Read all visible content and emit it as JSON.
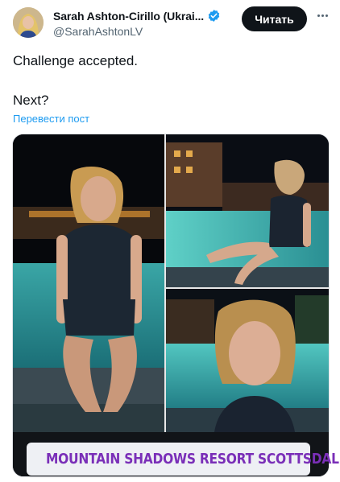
{
  "author": {
    "display_name": "Sarah Ashton-Cirillo (Ukrai...",
    "handle": "@SarahAshtonLV",
    "follow_label": "Читать"
  },
  "tweet": {
    "lines": [
      "Challenge accepted.",
      "Next?"
    ],
    "translate_label": "Перевести пост"
  },
  "media": {
    "location_sticker": "MOUNTAIN SHADOWS RESORT SCOTTSDALE"
  },
  "colors": {
    "accent": "#1d9bf0",
    "button_bg": "#0f1419",
    "secondary_text": "#536471",
    "sticker_text": "#7a2fb8"
  },
  "icons": [
    "verified-badge-icon",
    "more-options-icon",
    "location-pin-icon"
  ]
}
